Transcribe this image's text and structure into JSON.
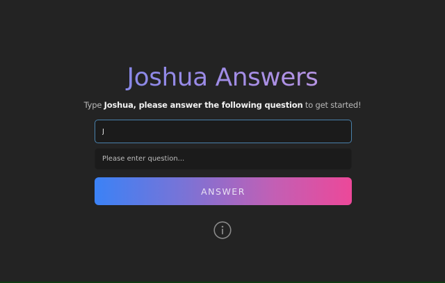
{
  "header": {
    "title": "Joshua Answers"
  },
  "subtitle": {
    "prefix": "Type ",
    "emphasis": "Joshua, please answer the following question",
    "suffix": " to get started!"
  },
  "form": {
    "name_value": "J",
    "question_placeholder": "Please enter question...",
    "question_value": ""
  },
  "actions": {
    "answer_label": "ANSWER"
  },
  "icons": {
    "info": "info-icon"
  },
  "colors": {
    "background": "#232323",
    "title_gradient_start": "#6c86ea",
    "title_gradient_end": "#d49fe0",
    "button_gradient_start": "#3b82f6",
    "button_gradient_end": "#ec4899",
    "focus_border": "#4a82ad"
  }
}
